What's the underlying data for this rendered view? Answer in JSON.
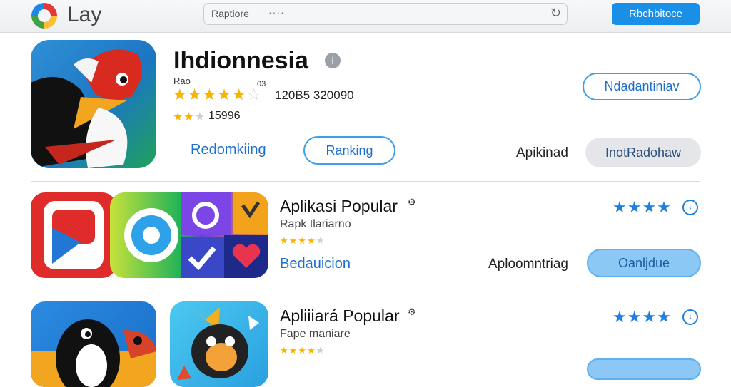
{
  "header": {
    "app_name": "Lay",
    "search_tag": "Raptiore",
    "search_value": "····",
    "reload_icon": "reload-icon",
    "top_button": "Rbchbitoce"
  },
  "featured": {
    "title": "Ihdionnesia",
    "info_icon": "info-icon",
    "label_small": "Rao",
    "rating_small": "03",
    "stars_main": "★★★★★",
    "rating_count": "120B5 320090",
    "stars_sub": "★★",
    "stars_sub_off": "★",
    "sub_count": "15996",
    "link_label": "Redomkiing",
    "ranking_button": "Ranking",
    "right_button": "Ndadantiniav",
    "side_label": "Apikinad",
    "grey_button": "InotRadohaw"
  },
  "rows": [
    {
      "title": "Aplikasi Popular",
      "subtitle": "Rapk Ilariarno",
      "stars_small": "★★★★",
      "stars_small_off": "★",
      "blue_stars": "★★★★",
      "link_label": "Bedauicion",
      "side_label": "Aploomntriag",
      "button_label": "Oanljdue"
    },
    {
      "title": "Apliiiará Popular",
      "subtitle": "Fape maniare",
      "stars_small": "★★★★",
      "stars_small_off": "★",
      "blue_stars": "★★★★"
    }
  ],
  "icons": {
    "download": "download-icon",
    "gear": "gear-icon"
  },
  "colors": {
    "accent": "#1a8fe8",
    "star": "#f6b400",
    "link": "#1c6fd1"
  }
}
